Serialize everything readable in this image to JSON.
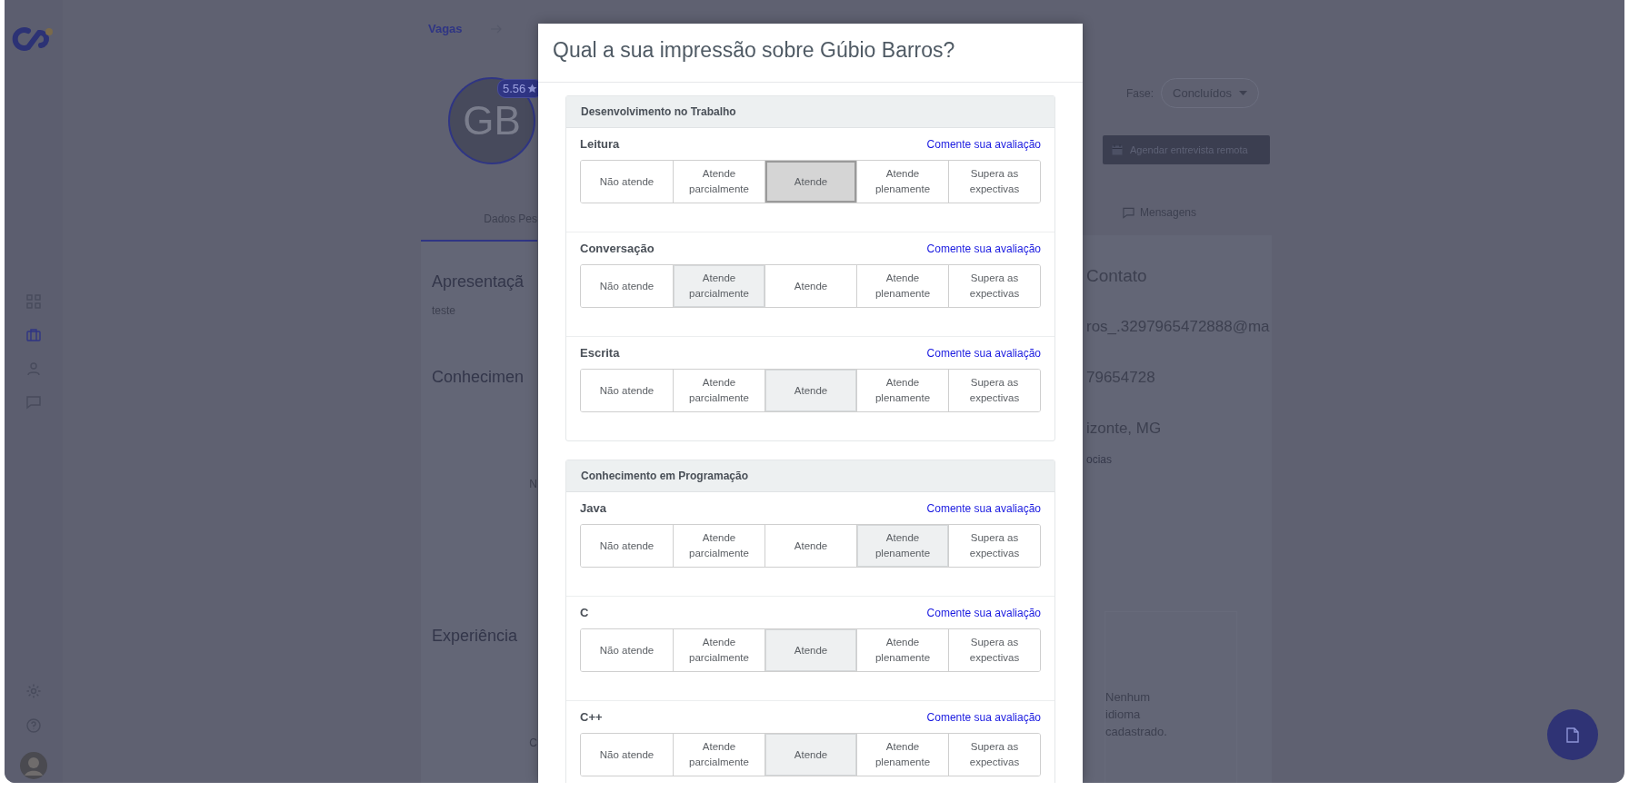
{
  "sidebar": {
    "items": [
      {
        "kind": "grid",
        "selected": false
      },
      {
        "kind": "briefcase",
        "selected": true
      },
      {
        "kind": "person",
        "selected": false
      },
      {
        "kind": "chat",
        "selected": false
      }
    ],
    "bottom_items": [
      {
        "kind": "gear"
      },
      {
        "kind": "help"
      },
      {
        "kind": "avatar"
      }
    ]
  },
  "breadcrumb": {
    "label": "Vagas"
  },
  "candidate": {
    "initials": "GB",
    "rating": "5.56"
  },
  "phase": {
    "label": "Fase:",
    "value": "Concluídos"
  },
  "schedule_button": {
    "label": "Agendar entrevista remota"
  },
  "tabs": [
    {
      "label": "Dados Pes",
      "selected": true
    },
    {
      "label": "Mensagens",
      "selected": false
    }
  ],
  "left_panel": [
    {
      "kind": "heading",
      "text": "Apresentaçã"
    },
    {
      "kind": "text",
      "text": "teste"
    },
    {
      "kind": "heading",
      "text": "Conhecimen"
    },
    {
      "kind": "boxed",
      "text": "N"
    },
    {
      "kind": "heading",
      "text": "Experiência"
    },
    {
      "kind": "boxed",
      "text": "C"
    }
  ],
  "right_panel": [
    {
      "kind": "heading",
      "text": "Contato"
    },
    {
      "kind": "contact",
      "text": "ros_.3297965472888@ma"
    },
    {
      "kind": "contact",
      "text": "79654728"
    },
    {
      "kind": "contact",
      "text": "izonte, MG"
    },
    {
      "kind": "note",
      "text": "ocias"
    },
    {
      "kind": "empty",
      "text": "Nenhum idioma cadastrado."
    }
  ],
  "dialog": {
    "title": "Qual a sua impressão sobre Gúbio Barros?",
    "sections": [
      {
        "title": "Desenvolvimento no Trabalho",
        "criteria": [
          {
            "name": "Leitura",
            "comment_link": "Comente sua avaliação",
            "focused": true,
            "options": [
              {
                "label": "Não atende",
                "selected": false
              },
              {
                "label": "Atende parcialmente",
                "selected": false
              },
              {
                "label": "Atende",
                "selected": true
              },
              {
                "label": "Atende plenamente",
                "selected": false
              },
              {
                "label": "Supera as expectivas",
                "selected": false
              }
            ]
          },
          {
            "name": "Conversação",
            "comment_link": "Comente sua avaliação",
            "focused": false,
            "options": [
              {
                "label": "Não atende",
                "selected": false
              },
              {
                "label": "Atende parcialmente",
                "selected": true
              },
              {
                "label": "Atende",
                "selected": false
              },
              {
                "label": "Atende plenamente",
                "selected": false
              },
              {
                "label": "Supera as expectivas",
                "selected": false
              }
            ]
          },
          {
            "name": "Escrita",
            "comment_link": "Comente sua avaliação",
            "focused": false,
            "options": [
              {
                "label": "Não atende",
                "selected": false
              },
              {
                "label": "Atende parcialmente",
                "selected": false
              },
              {
                "label": "Atende",
                "selected": true
              },
              {
                "label": "Atende plenamente",
                "selected": false
              },
              {
                "label": "Supera as expectivas",
                "selected": false
              }
            ]
          }
        ]
      },
      {
        "title": "Conhecimento em Programação",
        "criteria": [
          {
            "name": "Java",
            "comment_link": "Comente sua avaliação",
            "focused": false,
            "options": [
              {
                "label": "Não atende",
                "selected": false
              },
              {
                "label": "Atende parcialmente",
                "selected": false
              },
              {
                "label": "Atende",
                "selected": false
              },
              {
                "label": "Atende plenamente",
                "selected": true
              },
              {
                "label": "Supera as expectivas",
                "selected": false
              }
            ]
          },
          {
            "name": "C",
            "comment_link": "Comente sua avaliação",
            "focused": false,
            "options": [
              {
                "label": "Não atende",
                "selected": false
              },
              {
                "label": "Atende parcialmente",
                "selected": false
              },
              {
                "label": "Atende",
                "selected": true
              },
              {
                "label": "Atende plenamente",
                "selected": false
              },
              {
                "label": "Supera as expectivas",
                "selected": false
              }
            ]
          },
          {
            "name": "C++",
            "comment_link": "Comente sua avaliação",
            "focused": false,
            "options": [
              {
                "label": "Não atende",
                "selected": false
              },
              {
                "label": "Atende parcialmente",
                "selected": false
              },
              {
                "label": "Atende",
                "selected": true
              },
              {
                "label": "Atende plenamente",
                "selected": false
              },
              {
                "label": "Supera as expectivas",
                "selected": false
              }
            ]
          }
        ]
      }
    ]
  }
}
